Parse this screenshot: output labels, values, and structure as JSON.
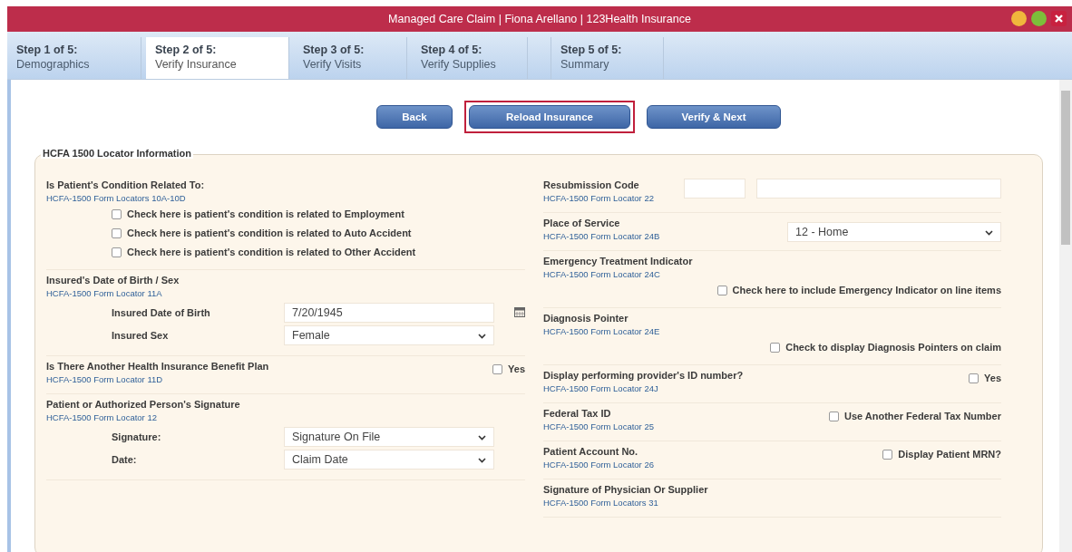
{
  "window": {
    "title": "Managed Care Claim | Fiona Arellano | 123Health Insurance"
  },
  "tabs": [
    {
      "step": "Step 1 of 5:",
      "label": "Demographics",
      "selected": false
    },
    {
      "step": "Step 2 of 5:",
      "label": "Verify Insurance",
      "selected": true
    },
    {
      "step": "Step 3 of 5:",
      "label": "Verify Visits",
      "selected": false
    },
    {
      "step": "Step 4 of 5:",
      "label": "Verify Supplies",
      "selected": false
    },
    {
      "step": "Step 5 of 5:",
      "label": "Summary",
      "selected": false
    }
  ],
  "buttons": [
    {
      "label": "Back",
      "highlighted": false
    },
    {
      "label": "Reload Insurance",
      "highlighted": true
    },
    {
      "label": "Verify & Next",
      "highlighted": false
    }
  ],
  "panel": {
    "legend": "HCFA 1500 Locator Information",
    "left": [
      {
        "label": "Is Patient's Condition Related To:",
        "locator": "HCFA-1500 Form Locators 10A-10D",
        "checks": [
          {
            "label": "Check here is patient's condition is related to Employment",
            "checked": false
          },
          {
            "label": "Check here is patient's condition is related to Auto Accident",
            "checked": false
          },
          {
            "label": "Check here is patient's condition is related to Other Accident",
            "checked": false
          }
        ]
      },
      {
        "label": "Insured's Date of Birth / Sex",
        "locator": "HCFA-1500 Form Locator 11A",
        "fields": [
          {
            "kind": "date",
            "label": "Insured Date of Birth",
            "value": "7/20/1945"
          },
          {
            "kind": "select",
            "label": "Insured Sex",
            "value": "Female"
          }
        ]
      },
      {
        "label": "Is There Another Health Insurance Benefit Plan",
        "locator": "HCFA-1500 Form Locator 11D",
        "side": [
          {
            "kind": "checkbox",
            "label": "Yes",
            "checked": false
          }
        ]
      },
      {
        "label": "Patient or Authorized Person's Signature",
        "locator": "HCFA-1500 Form Locator 12",
        "fields": [
          {
            "kind": "select",
            "label": "Signature:",
            "value": "Signature On File"
          },
          {
            "kind": "select",
            "label": "Date:",
            "value": "Claim Date"
          }
        ]
      }
    ],
    "right": [
      {
        "label": "Resubmission Code",
        "locator": "HCFA-1500 Form Locator 22",
        "side": [
          {
            "kind": "text"
          },
          {
            "kind": "text"
          }
        ]
      },
      {
        "label": "Place of Service",
        "locator": "HCFA-1500 Form Locator 24B",
        "side": [
          {
            "kind": "select",
            "value": "12 - Home"
          }
        ]
      },
      {
        "label": "Emergency Treatment Indicator",
        "locator": "HCFA-1500 Form Locator 24C",
        "checks": [
          {
            "label": "Check here to include Emergency Indicator on line items",
            "checked": false
          }
        ]
      },
      {
        "label": "Diagnosis Pointer",
        "locator": "HCFA-1500 Form Locator 24E",
        "checks": [
          {
            "label": "Check to display Diagnosis Pointers on claim",
            "checked": false
          }
        ]
      },
      {
        "label": "Display performing provider's ID number?",
        "locator": "HCFA-1500 Form Locator 24J",
        "side": [
          {
            "kind": "checkbox",
            "label": "Yes",
            "checked": false
          }
        ]
      },
      {
        "label": "Federal Tax ID",
        "locator": "HCFA-1500 Form Locator 25",
        "side": [
          {
            "kind": "checkbox",
            "label": "Use Another Federal Tax Number",
            "checked": false
          }
        ]
      },
      {
        "label": "Patient Account No.",
        "locator": "HCFA-1500 Form Locator 26",
        "side": [
          {
            "kind": "checkbox",
            "label": "Display Patient MRN?",
            "checked": false
          }
        ]
      },
      {
        "label": "Signature of Physician Or Supplier",
        "locator": "HCFA-1500 Form Locators 31"
      }
    ]
  }
}
